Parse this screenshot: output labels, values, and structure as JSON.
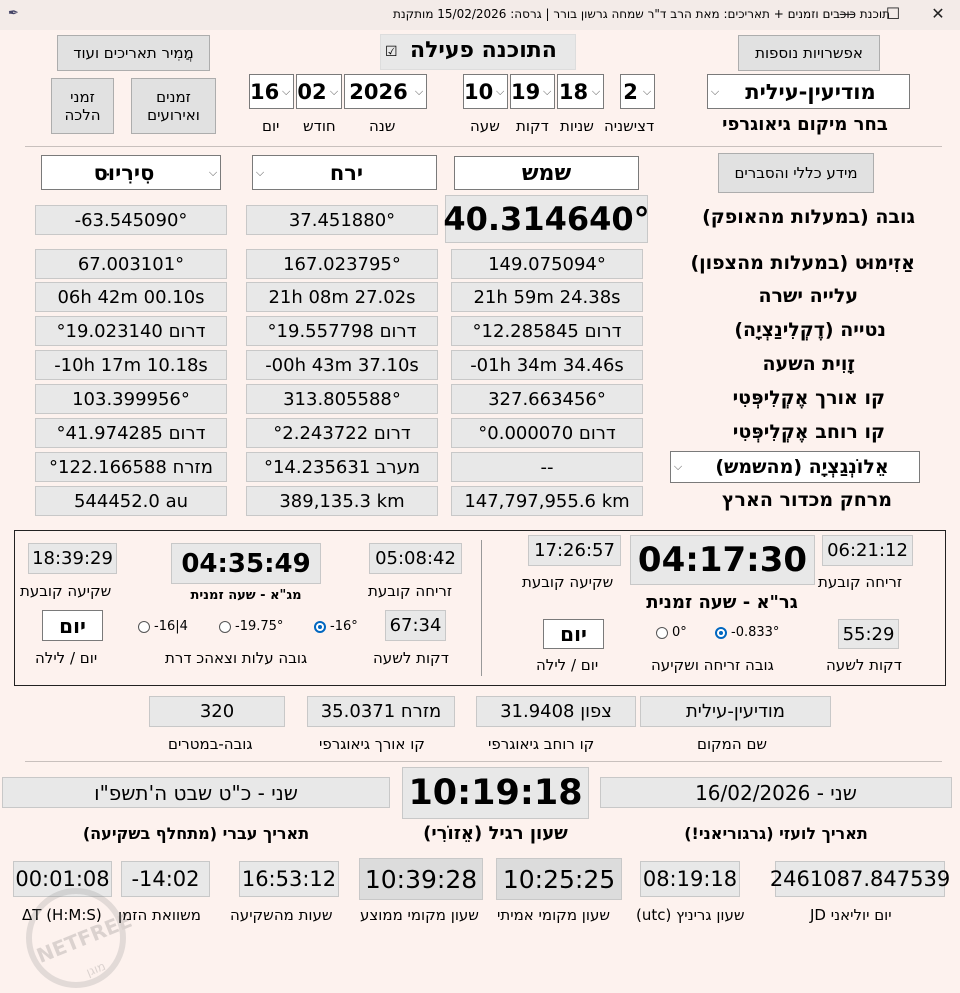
{
  "window": {
    "title": "תוכנת כוכבים וזמנים + תאריכים:  מאת הרב ד\"ר שמחה גרשון בורר | גרסה: 15/02/2026 מותקנת",
    "min": "—",
    "max": "☐",
    "close": "✕"
  },
  "top": {
    "more_options": "אפשרויות נוספות",
    "active_label": "התוכנה פעילה",
    "active_check": "☑",
    "converter": "מֲמִיר תאריכים ועוד",
    "events_button": "זמנים\nואירועים",
    "halacha_button": "זמני\nהלכה",
    "location_value": "מודיעין-עילית",
    "location_label": "בחר מיקום גיאוגרפי",
    "centisec": "2",
    "seconds": "18",
    "minutes": "19",
    "hour": "10",
    "year": "2026",
    "month": "02",
    "day": "16",
    "labels": {
      "centisec": "דצישניה",
      "seconds": "שניות",
      "minutes": "דקות",
      "hour": "שעה",
      "year": "שנה",
      "month": "חודש",
      "day": "יום"
    }
  },
  "celestial": {
    "info_button": "מידע כללי והסברים",
    "sun": "שמש",
    "moon": "ירח",
    "star": "סִירִיוּס",
    "rows": [
      {
        "label": "גובה (במעלות מהאופק)",
        "sun": "40.314640°",
        "moon": "37.451880°",
        "star": "-63.545090°"
      },
      {
        "label": "אַזִימוּט (במעלות מהצפון)",
        "sun": "149.075094°",
        "moon": "167.023795°",
        "star": "67.003101°"
      },
      {
        "label": "עלייה ישרה",
        "sun": "21h 59m 24.38s",
        "moon": "21h 08m 27.02s",
        "star": "06h 42m 00.10s"
      },
      {
        "label": "נטייה (דֶקְלִינַצְיָה)",
        "sun": "דרום °12.285845",
        "moon": "דרום °19.557798",
        "star": "דרום °19.023140"
      },
      {
        "label": "זָוִית השעה",
        "sun": "-01h 34m 34.46s",
        "moon": "-00h 43m 37.10s",
        "star": "-10h 17m 10.18s"
      },
      {
        "label": "קו אורך אֶקְלִיפְּטִי",
        "sun": "327.663456°",
        "moon": "313.805588°",
        "star": "103.399956°"
      },
      {
        "label": "קו רוחב אֶקְלִיפְּטִי",
        "sun": "דרום °0.000070",
        "moon": "דרום °2.243722",
        "star": "דרום °41.974285"
      },
      {
        "label": "אֵלוֹנְגַצְיָה (מהשמש)",
        "sun": "--",
        "moon": "מערב °14.235631",
        "star": "מזרח °122.166588"
      },
      {
        "label": "מרחק מכדור הארץ",
        "sun": "147,797,955.6 km",
        "moon": "389,135.3 km",
        "star": "544452.0 au"
      }
    ]
  },
  "gra": {
    "sunrise": "06:21:12",
    "sunrise_label": "זריחה קובעת",
    "sunset": "17:26:57",
    "sunset_label": "שקיעה קובעת",
    "hour": "04:17:30",
    "hour_label": "גר\"א - שעה זמנית",
    "minutes": "55:29",
    "minutes_label": "דקות לשעה",
    "radio_label": "גובה זריחה ושקיעה",
    "r1": "-0.833°",
    "r2": "0°",
    "day": "יום",
    "day_label": "יום / לילה"
  },
  "mga": {
    "sunrise": "05:08:42",
    "sunrise_label": "זריחה קובעת",
    "sunset": "18:39:29",
    "sunset_label": "שקיעה קובעת",
    "hour": "04:35:49",
    "hour_label": "מג\"א - שעה זמנית",
    "minutes": "67:34",
    "minutes_label": "דקות לשעה",
    "radio_label": "גובה עלות וצאהכ דרת",
    "r1": "-16°",
    "r2": "-19.75°",
    "r3": "-16|4",
    "day": "יום",
    "day_label": "יום / לילה"
  },
  "place": {
    "name": "מודיעין-עילית",
    "name_label": "שם המקום",
    "lat": "צפון 31.9408",
    "lat_label": "קו רוחב גיאוגרפי",
    "lon": "מזרח 35.0371",
    "lon_label": "קו אורך גיאוגרפי",
    "alt": "320",
    "alt_label": "גובה-במטרים"
  },
  "dates": {
    "greg": "שני - 16/02/2026",
    "greg_label": "תאריך לועזי (גרגוריאני!)",
    "time": "10:19:18",
    "time_label": "שעון רגיל (אֵזוֹרִי)",
    "hebrew": "שני - כ\"ט שבט ה'תשפ\"ו",
    "hebrew_label": "תאריך עברי (מתחלף בשקיעה)"
  },
  "bottom": {
    "jd": "2461087.847539",
    "jd_label": "יום יוליאני JD",
    "utc": "08:19:18",
    "utc_label": "שעון גריניץ (utc)",
    "true_local": "10:25:25",
    "true_local_label": "שעון מקומי אמיתי",
    "mean_local": "10:39:28",
    "mean_local_label": "שעון מקומי ממוצע",
    "from_sunset": "16:53:12",
    "from_sunset_label": "שעות מהשקיעה",
    "eot": "-14:02",
    "eot_label": "משוואת הזמן",
    "dt": "00:01:08",
    "dt_label": "ΔT (H:M:S)"
  },
  "watermark": {
    "text": "NETFREE",
    "sub": "מוגן"
  }
}
